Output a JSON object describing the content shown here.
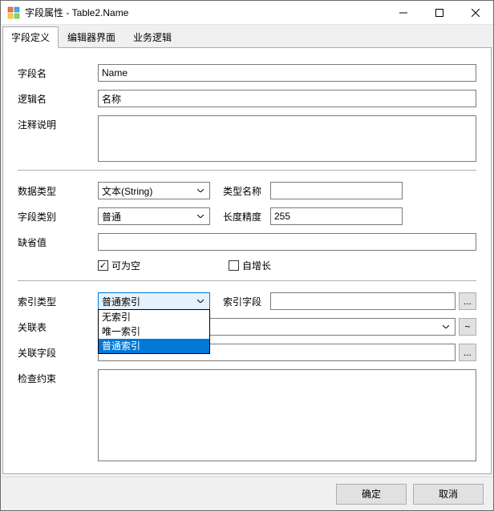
{
  "window": {
    "title": "字段属性 - Table2.Name"
  },
  "tabs": {
    "definition": "字段定义",
    "editor": "编辑器界面",
    "logic": "业务逻辑"
  },
  "labels": {
    "fieldName": "字段名",
    "logicName": "逻辑名",
    "comment": "注释说明",
    "dataType": "数据类型",
    "typeName": "类型名称",
    "fieldCategory": "字段类别",
    "lengthPrecision": "长度精度",
    "defaultValue": "缺省值",
    "nullable": "可为空",
    "autoIncrement": "自增长",
    "indexType": "索引类型",
    "indexField": "索引字段",
    "relatedTable": "关联表",
    "relatedField": "关联字段",
    "checkConstraint": "检查约束"
  },
  "values": {
    "fieldName": "Name",
    "logicName": "名称",
    "comment": "",
    "dataType": "文本(String)",
    "typeName": "",
    "fieldCategory": "普通",
    "lengthPrecision": "255",
    "defaultValue": "",
    "nullable": true,
    "autoIncrement": false,
    "indexType": "普通索引",
    "indexField": "",
    "relatedTable": "",
    "relatedField": "",
    "checkConstraint": ""
  },
  "indexDropdown": {
    "opt0": "无索引",
    "opt1": "唯一索引",
    "opt2": "普通索引"
  },
  "buttons": {
    "ellipsis": "...",
    "tilde": "~",
    "ok": "确定",
    "cancel": "取消"
  }
}
